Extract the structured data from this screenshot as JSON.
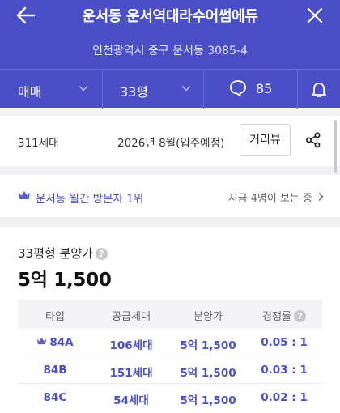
{
  "header": {
    "title": "운서동 운서역대라수어썸에듀",
    "address": "인천광역시 중구 운서동 3085-4",
    "colors": {
      "brand": "#4b4fc6",
      "accent_text": "#4b4fc6"
    }
  },
  "tabs": {
    "sale_type": "매매",
    "size": "33평",
    "comment_count": "85"
  },
  "info": {
    "households": "311세대",
    "move_in": "2026년 8월(입주예정)",
    "street_view_button": "거리뷰"
  },
  "visitor": {
    "rank_text": "운서동 월간 방문자 1위",
    "viewing_text": "지금 4명이 보는 중"
  },
  "price": {
    "label": "33평형 분양가",
    "value": "5억 1,500",
    "columns": [
      "타입",
      "공급세대",
      "분양가",
      "경쟁률"
    ],
    "rows": [
      {
        "type": "84A",
        "households": "106세대",
        "price": "5억 1,500",
        "competition": "0.05 : 1",
        "crown": true
      },
      {
        "type": "84B",
        "households": "151세대",
        "price": "5억 1,500",
        "competition": "0.03 : 1",
        "crown": false
      },
      {
        "type": "84C",
        "households": "54세대",
        "price": "5억 1,500",
        "competition": "0.02 : 1",
        "crown": false
      }
    ]
  },
  "icons": [
    "back-arrow-icon",
    "close-icon",
    "chevron-down-icon",
    "comment-bubble-icon",
    "bell-icon",
    "share-icon",
    "crown-icon",
    "help-icon",
    "chevron-right-icon"
  ]
}
